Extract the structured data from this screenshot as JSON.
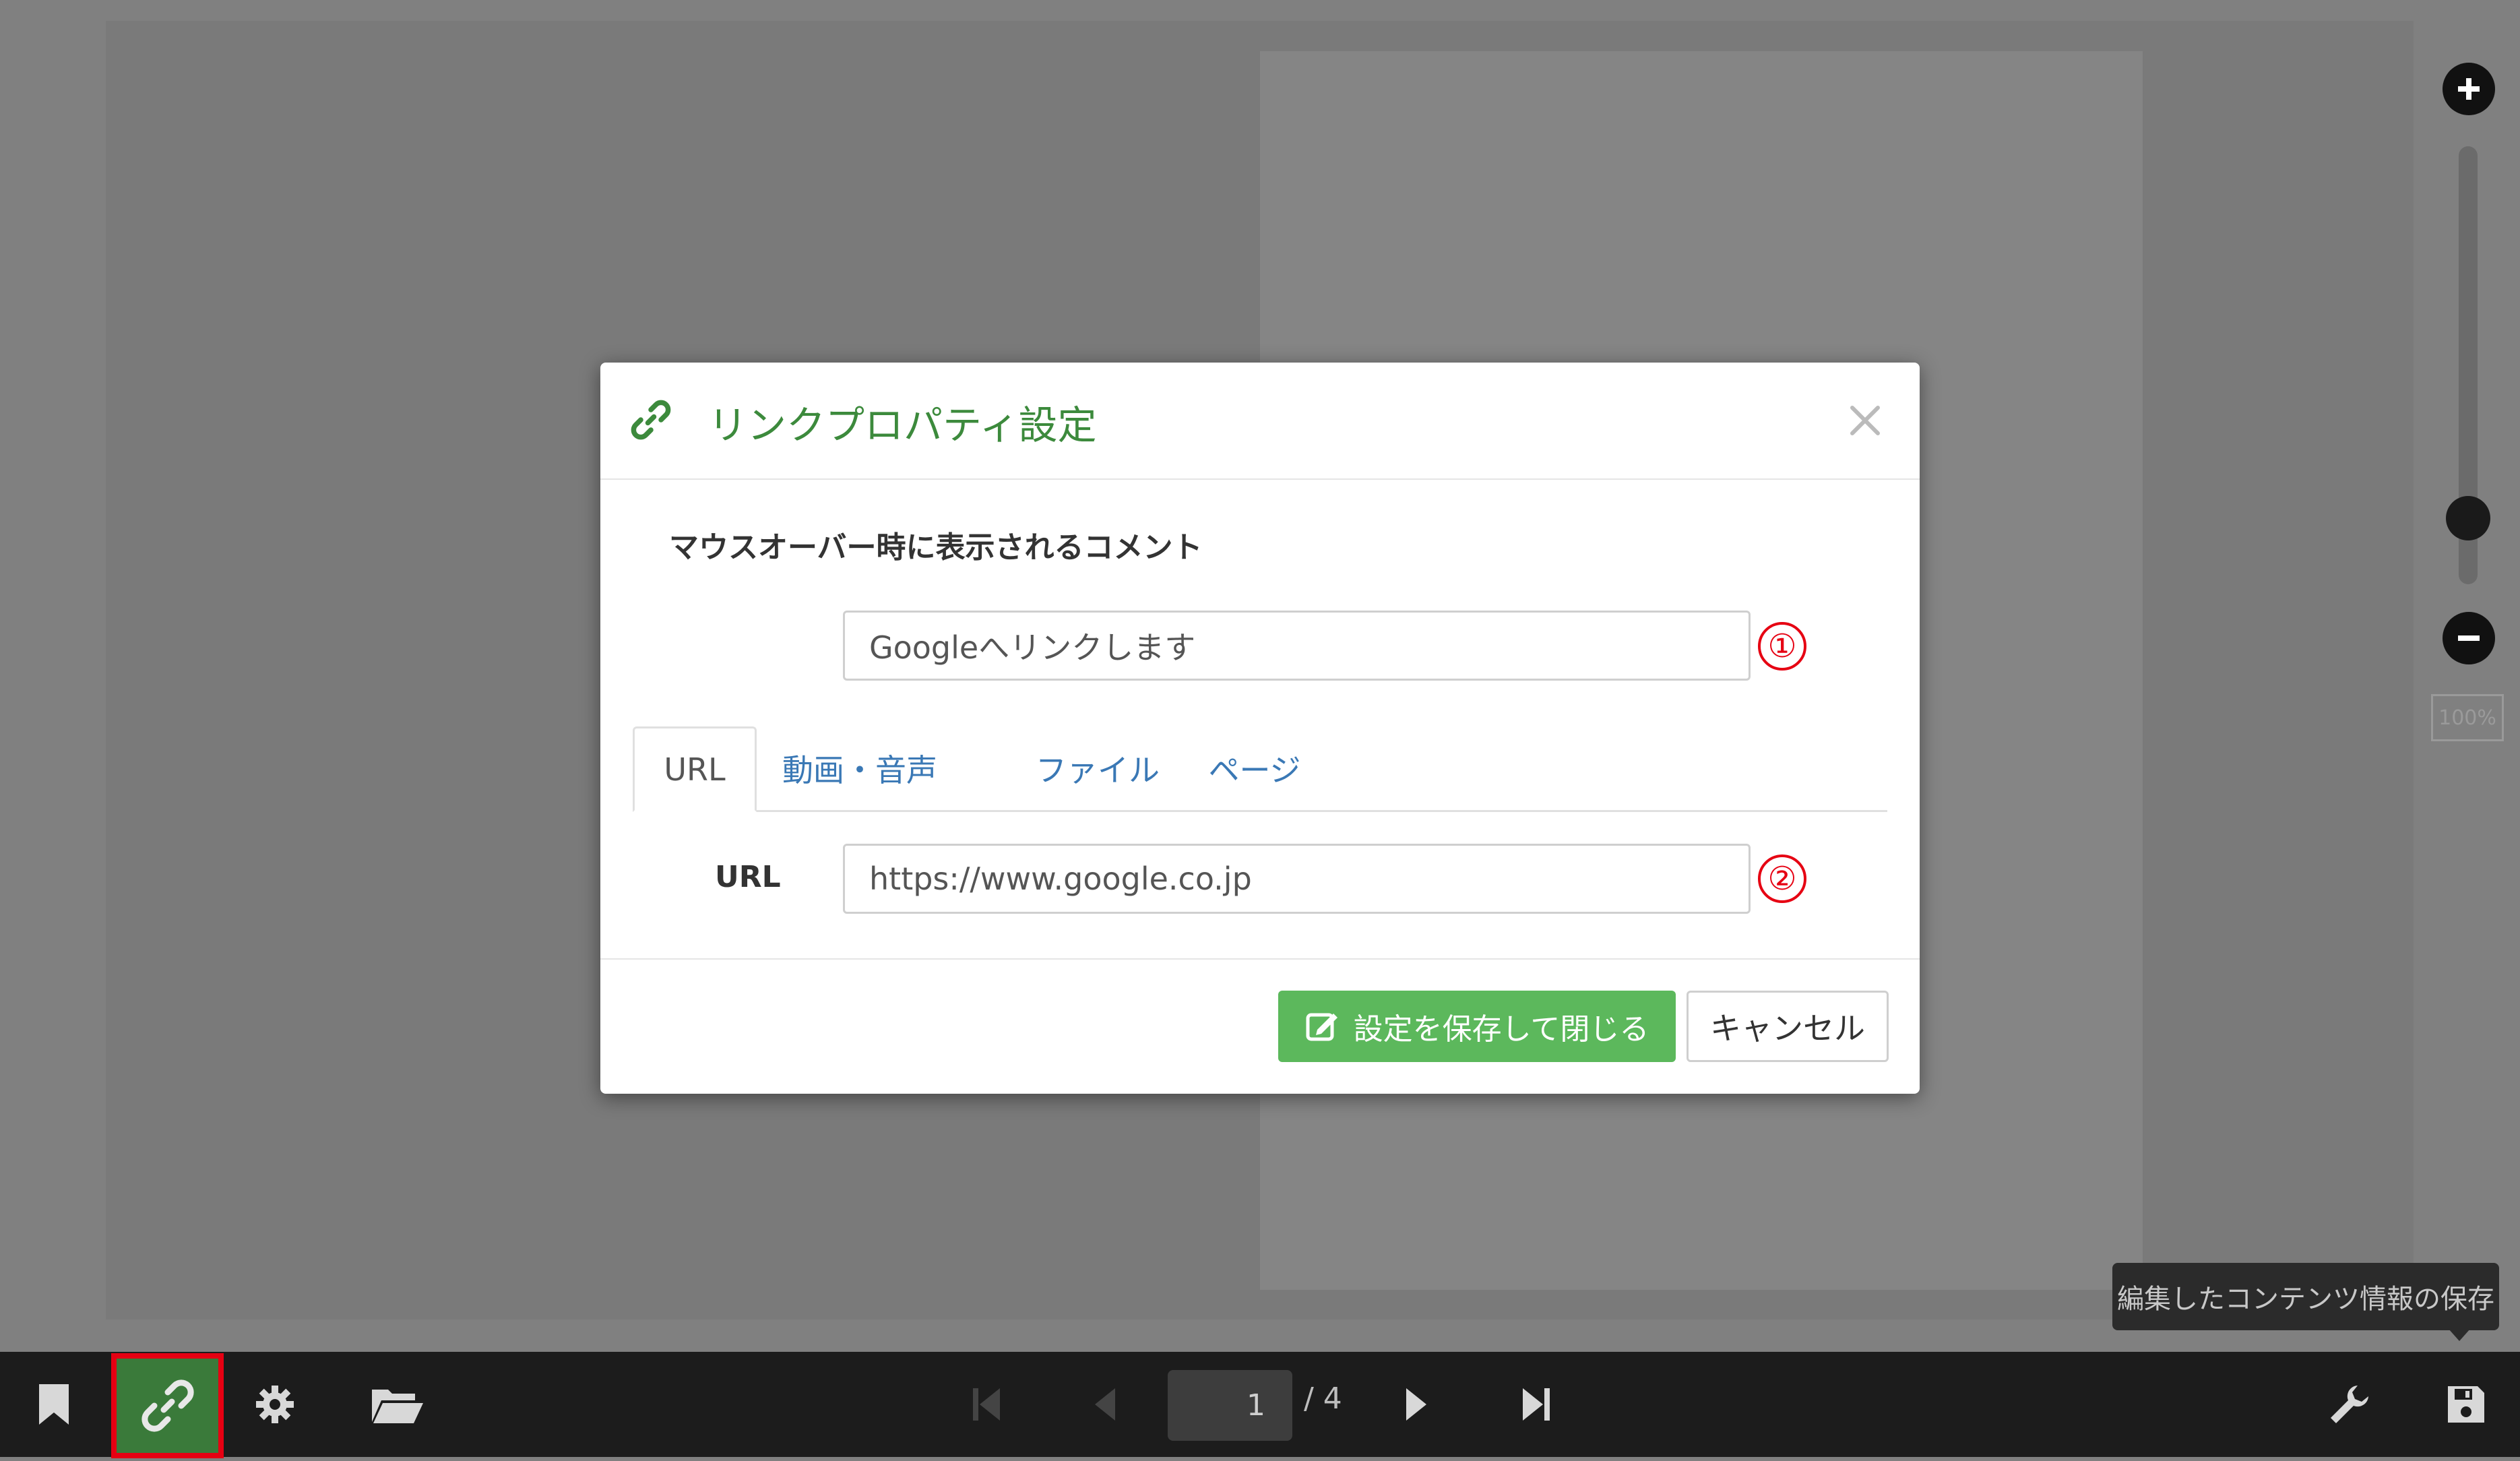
{
  "modal": {
    "title": "リンクプロパティ設定",
    "comment_label": "マウスオーバー時に表示されるコメント",
    "comment_value": "Googleへリンクします",
    "tabs": [
      {
        "label": "URL"
      },
      {
        "label": "動画・音声"
      },
      {
        "label": "ファイル"
      },
      {
        "label": "ページ"
      }
    ],
    "url_label": "URL",
    "url_value": "https://www.google.co.jp",
    "save_label": "設定を保存して閉じる",
    "cancel_label": "キャンセル",
    "markers": [
      "①",
      "②"
    ]
  },
  "zoom": {
    "level": "100%"
  },
  "tooltip": {
    "text": "編集したコンテンツ情報の保存"
  },
  "toolbar": {
    "page_current": "1",
    "page_total": "/ 4"
  },
  "colors": {
    "accent_green": "#3c8a3c",
    "button_green": "#5cb85c",
    "highlight_red": "#e60012",
    "tab_link_blue": "#3a78b5"
  },
  "icons": {
    "header": "link-icon",
    "close": "close-icon",
    "save_button": "edit-icon",
    "toolbar": [
      "bookmark-icon",
      "link-icon",
      "gear-icon",
      "folder-open-icon",
      "first-page-icon",
      "prev-page-icon",
      "next-page-icon",
      "last-page-icon",
      "wrench-icon",
      "save-icon"
    ]
  }
}
